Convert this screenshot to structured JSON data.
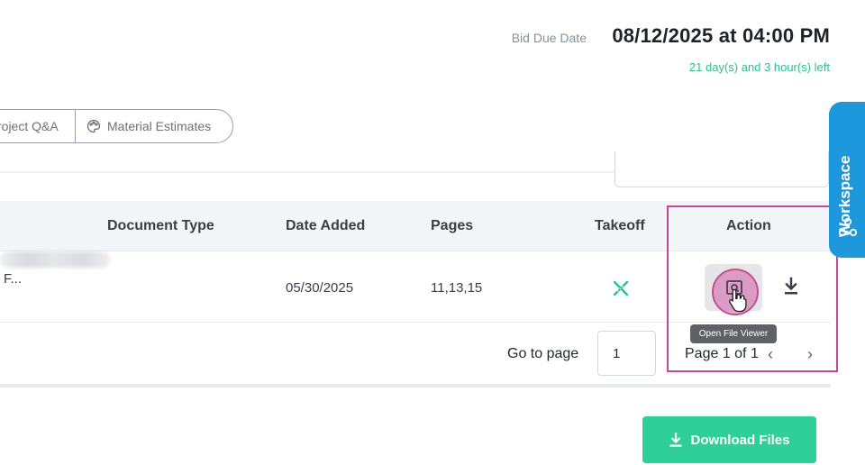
{
  "header": {
    "bid_due_label": "Bid Due Date",
    "bid_due_value": "08/12/2025 at 04:00 PM",
    "time_left": "21 day(s) and 3 hour(s) left"
  },
  "tabs": [
    {
      "label": "roject Q&A"
    },
    {
      "label": "Material Estimates",
      "icon": "palette-icon"
    }
  ],
  "table": {
    "columns": [
      "Document Type",
      "Date Added",
      "Pages",
      "Takeoff",
      "Action"
    ],
    "rows": [
      {
        "name": "F...",
        "document_type": "",
        "date_added": "05/30/2025",
        "pages": "11,13,15",
        "takeoff_icon": "ruler-pencil-icon"
      }
    ]
  },
  "tooltip": "Open File Viewer",
  "pagination": {
    "goto_label": "Go to page",
    "goto_value": "1",
    "page_info": "Page 1 of 1",
    "prev": "‹",
    "next": "›"
  },
  "download_button": "Download Files",
  "workspace": {
    "label": "Workspace"
  },
  "colors": {
    "accent_green": "#2fcf9a",
    "time_left_green": "#2fbf8e",
    "workspace_blue": "#1e98dc",
    "highlight_magenta": "#c4489a"
  }
}
